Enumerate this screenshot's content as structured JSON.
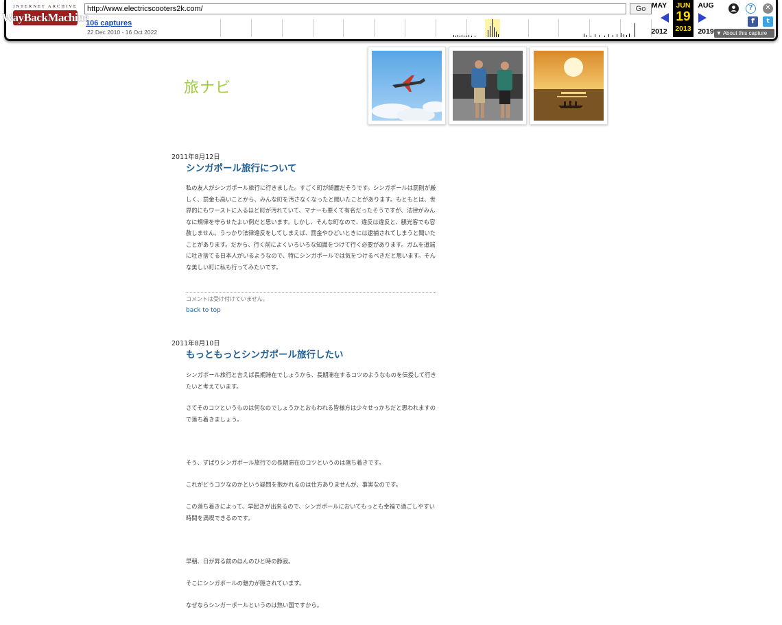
{
  "wayback": {
    "logo_top": "INTERNET ARCHIVE",
    "logo_main": "WayBackMachine",
    "url": "http://www.electricscooters2k.com/",
    "go": "Go",
    "captures": "106 captures",
    "range": "22 Dec 2010 - 16 Oct 2022",
    "prev_month": "MAY",
    "prev_year": "2012",
    "cur_month": "JUN",
    "cur_day": "19",
    "cur_year": "2013",
    "next_month": "AUG",
    "next_year": "2019",
    "about": "About this capture",
    "colors": {
      "accent_blue": "#2a45c8",
      "highlight": "#ffd800",
      "logo_red": "#9e1c1c"
    }
  },
  "site": {
    "title": "旅ナビ",
    "title_color": "#9fce3c",
    "thumbnails": [
      {
        "icon": "airplane-photo"
      },
      {
        "icon": "backpackers-photo"
      },
      {
        "icon": "sunset-sea-photo"
      }
    ]
  },
  "posts": [
    {
      "date": "2011年8月12日",
      "title": "シンガポール旅行について",
      "paragraphs": [
        "私の友人がシンガポール旅行に行きました。すごく町が綺麗だそうです。シンガポールは罰則が厳しく、罰金も高いことから、みんな町を汚さなくなったと聞いたことがあります。もともとは、世界的にもワーストに入るほど町が汚れていて、マナーも悪くて有名だったそうですが、法律がみんなに規律を守らせたよい例だと思います。しかし、そんな町なので、違反は違反と、観光客でも容赦しません。うっかり法律違反をしてしまえば、罰金やひどいときには逮捕されてしまうと聞いたことがあります。だから、行く前によくいろいろな知識をつけて行く必要があります。ガムを道端に吐き捨てる日本人がいるようなので、特にシンガポールでは気をつけるべきだと思います。そんな美しい町に私も行ってみたいです。"
      ],
      "comment_note": "コメントは受け付けていません。",
      "back_to_top": "back to top"
    },
    {
      "date": "2011年8月10日",
      "title": "もっともっとシンガポール旅行したい",
      "paragraphs": [
        "シンガポール旅行と言えば長期滞在でしょうから、長期滞在するコツのようなものを伝授して行きたいと考えています。",
        "さてそのコツというものは何なのでしょうかとおもわれる皆様方は少々せっかちだと思われますので落ち着きましょう。",
        "そう、ずばりシンガポール旅行での長期滞在のコツというのは落ち着きです。",
        "これがどうコツなのかという疑問を抱かれるのは仕方ありませんが、事実なのです。",
        "この落ち着きによって、早起きが出来るので、シンガポールにおいてもっとも幸福で過ごしやすい時間を満喫できるのです。",
        "早朝、日が昇る前のほんのひと時の静寂。",
        "そこにシンガポールの魅力が隠されています。",
        "なぜならシンガーポールというのは熱い国ですから。"
      ]
    }
  ]
}
